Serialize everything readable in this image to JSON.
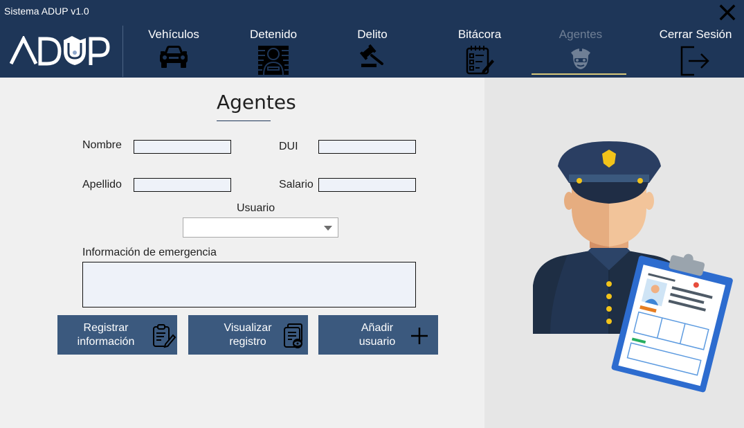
{
  "window": {
    "title": "Sistema ADUP v1.0"
  },
  "logo": {
    "text": "ADUP"
  },
  "nav": {
    "items": [
      {
        "label": "Vehículos",
        "icon": "car-icon"
      },
      {
        "label": "Detenido",
        "icon": "detainee-icon"
      },
      {
        "label": "Delito",
        "icon": "gavel-icon"
      },
      {
        "label": "Bitácora",
        "icon": "logbook-icon"
      },
      {
        "label": "Agentes",
        "icon": "police-officer-icon",
        "active": true
      },
      {
        "label": "Cerrar Sesión",
        "icon": "logout-icon"
      }
    ]
  },
  "form": {
    "title": "Agentes",
    "nombre_label": "Nombre",
    "nombre_value": "",
    "dui_label": "DUI",
    "dui_value": "",
    "apellido_label": "Apellido",
    "apellido_value": "",
    "salario_label": "Salario",
    "salario_value": "",
    "usuario_label": "Usuario",
    "usuario_value": "",
    "emergencia_label": "Información de emergencia",
    "emergencia_value": ""
  },
  "buttons": {
    "register": {
      "line1": "Registrar",
      "line2": "información",
      "icon": "clipboard-pencil-icon"
    },
    "view": {
      "line1": "Visualizar",
      "line2": "registro",
      "icon": "document-view-icon"
    },
    "add": {
      "line1": "Añadir",
      "line2": "usuario",
      "icon": "plus-icon"
    }
  },
  "colors": {
    "header_bg": "#1e3658",
    "button_bg": "#3b597e",
    "input_bg": "#eef2f9",
    "active_underline": "#d8c87a",
    "active_nav_text": "#6f7f95"
  }
}
